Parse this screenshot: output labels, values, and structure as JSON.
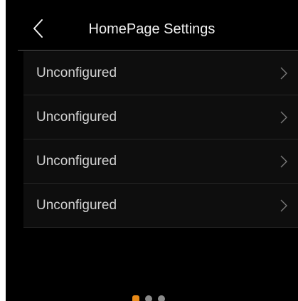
{
  "header": {
    "title": "HomePage Settings",
    "back_icon": "chevron-left-icon"
  },
  "list": {
    "items": [
      {
        "label": "Unconfigured",
        "icon": "chevron-right-icon"
      },
      {
        "label": "Unconfigured",
        "icon": "chevron-right-icon"
      },
      {
        "label": "Unconfigured",
        "icon": "chevron-right-icon"
      },
      {
        "label": "Unconfigured",
        "icon": "chevron-right-icon"
      }
    ]
  },
  "pager": {
    "page_count": 3,
    "active_page": 1,
    "active_color": "#e88a18",
    "inactive_color": "#8a8a8a"
  },
  "colors": {
    "background": "#000000",
    "row_background": "#0e0e0e",
    "text": "#d3d3d3",
    "title": "#f2f2f2"
  }
}
